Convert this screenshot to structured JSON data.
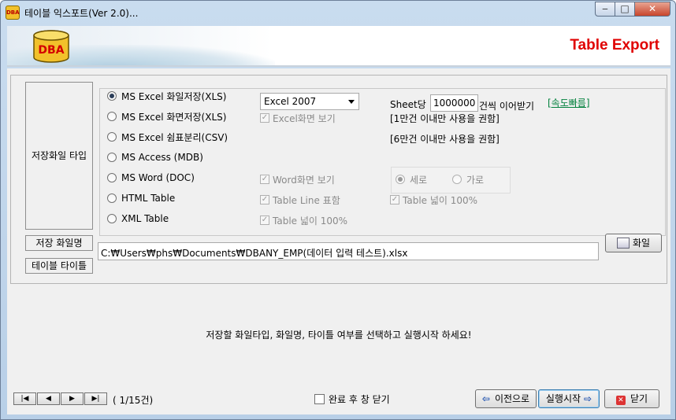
{
  "window": {
    "title": "테이블 익스포트(Ver 2.0)...",
    "min_label": "‒",
    "max_label": "□",
    "close_label": "✕",
    "app_icon_text": "DBA"
  },
  "banner": {
    "logo_text": "DBA",
    "title": "Table Export"
  },
  "labels": {
    "save_file_type": "저장화일 타입",
    "save_file_name": "저장 화일명",
    "table_title": "테이블 타이틀"
  },
  "options": [
    {
      "label": "MS Excel 화일저장(XLS)",
      "selected": true
    },
    {
      "label": "MS Excel 화면저장(XLS)",
      "selected": false
    },
    {
      "label": "MS Excel 쉼표분리(CSV)",
      "selected": false
    },
    {
      "label": "MS Access (MDB)",
      "selected": false
    },
    {
      "label": "MS Word (DOC)",
      "selected": false
    },
    {
      "label": "HTML Table",
      "selected": false
    },
    {
      "label": "XML Table",
      "selected": false
    }
  ],
  "excel_version": {
    "selected": "Excel 2007"
  },
  "sheet": {
    "prefix": "Sheet당",
    "value": "1000000",
    "suffix": "건씩 이어받기",
    "speed_link": "[속도빠름]"
  },
  "checks": {
    "excel_view": "Excel화면 보기",
    "word_view": "Word화면 보기",
    "table_line": "Table Line 표함",
    "table_width_1": "Table 넓이 100%",
    "table_width_2": "Table 넓이 100%"
  },
  "notes": {
    "note_10k": "[1만건 이내만 사용을 권함]",
    "note_60k": "[6만건 이내만 사용을 권함]"
  },
  "orientation": {
    "vertical": "세로",
    "horizontal": "가로"
  },
  "file_path": "C:₩Users₩phs₩Documents₩DBANY_EMP(데이터 입력 테스트).xlsx",
  "file_button": "화일",
  "message": "저장할 화일타입, 화일명, 타이틀 여부를 선택하고 실행시작 하세요!",
  "nav": {
    "first": "|◀",
    "prev": "◀",
    "next": "▶",
    "last": "▶|",
    "counter": "( 1/15건)"
  },
  "footer": {
    "close_after": "완료 후 창 닫기",
    "prev_button": "이전으로",
    "run_button": "실행시작",
    "close_button": "닫기"
  }
}
